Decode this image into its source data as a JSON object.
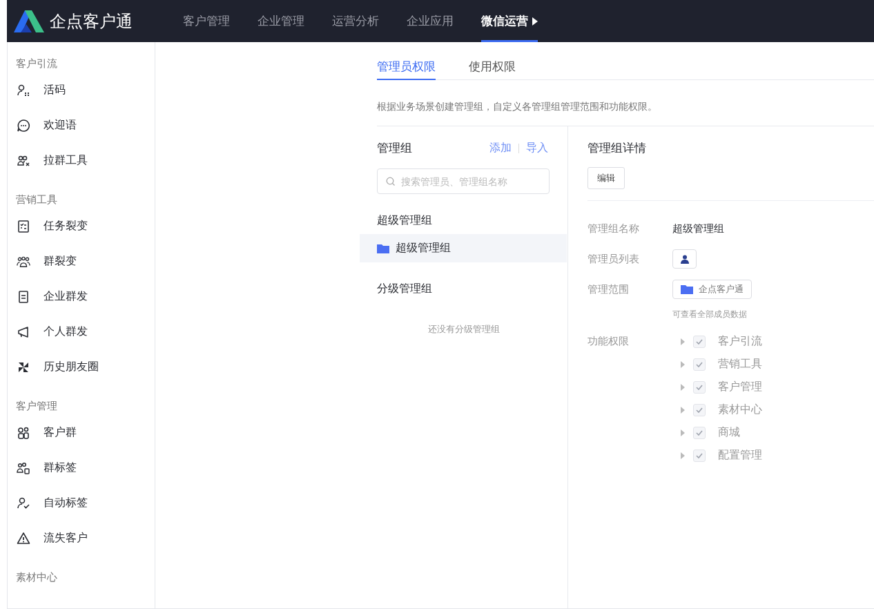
{
  "brand": {
    "name": "企点客户通"
  },
  "nav": [
    {
      "label": "客户管理",
      "selected": false
    },
    {
      "label": "企业管理",
      "selected": false
    },
    {
      "label": "运营分析",
      "selected": false
    },
    {
      "label": "企业应用",
      "selected": false
    },
    {
      "label": "微信运营",
      "selected": true
    }
  ],
  "sidebar": [
    {
      "title": "客户引流",
      "items": [
        "活码",
        "欢迎语",
        "拉群工具"
      ]
    },
    {
      "title": "营销工具",
      "items": [
        "任务裂变",
        "群裂变",
        "企业群发",
        "个人群发",
        "历史朋友圈"
      ]
    },
    {
      "title": "客户管理",
      "items": [
        "客户群",
        "群标签",
        "自动标签",
        "流失客户"
      ]
    },
    {
      "title": "素材中心"
    }
  ],
  "tabs": [
    {
      "label": "管理员权限",
      "selected": true
    },
    {
      "label": "使用权限",
      "selected": false
    }
  ],
  "description": "根据业务场景创建管理组，自定义各管理组管理范围和功能权限。",
  "groups_panel": {
    "title": "管理组",
    "actions": [
      "添加",
      "导入"
    ],
    "search_placeholder": "搜索管理员、管理组名称",
    "sections": [
      {
        "title": "超级管理组",
        "items": [
          {
            "label": "超级管理组",
            "selected": true
          }
        ]
      },
      {
        "title": "分级管理组",
        "empty_text": "还没有分级管理组"
      }
    ]
  },
  "details": {
    "title": "管理组详情",
    "edit_button": "编辑",
    "name_label": "管理组名称",
    "name_value": "超级管理组",
    "admins_label": "管理员列表",
    "scope_label": "管理范围",
    "scope_value": "企点客户通",
    "scope_hint": "可查看全部成员数据",
    "permissions_label": "功能权限",
    "permissions": [
      {
        "label": "客户引流",
        "checked": true,
        "disabled": true
      },
      {
        "label": "营销工具",
        "checked": true,
        "disabled": true
      },
      {
        "label": "客户管理",
        "checked": true,
        "disabled": true
      },
      {
        "label": "素材中心",
        "checked": true,
        "disabled": true
      },
      {
        "label": "商城",
        "checked": true,
        "disabled": true
      },
      {
        "label": "配置管理",
        "checked": true,
        "disabled": true
      }
    ]
  }
}
